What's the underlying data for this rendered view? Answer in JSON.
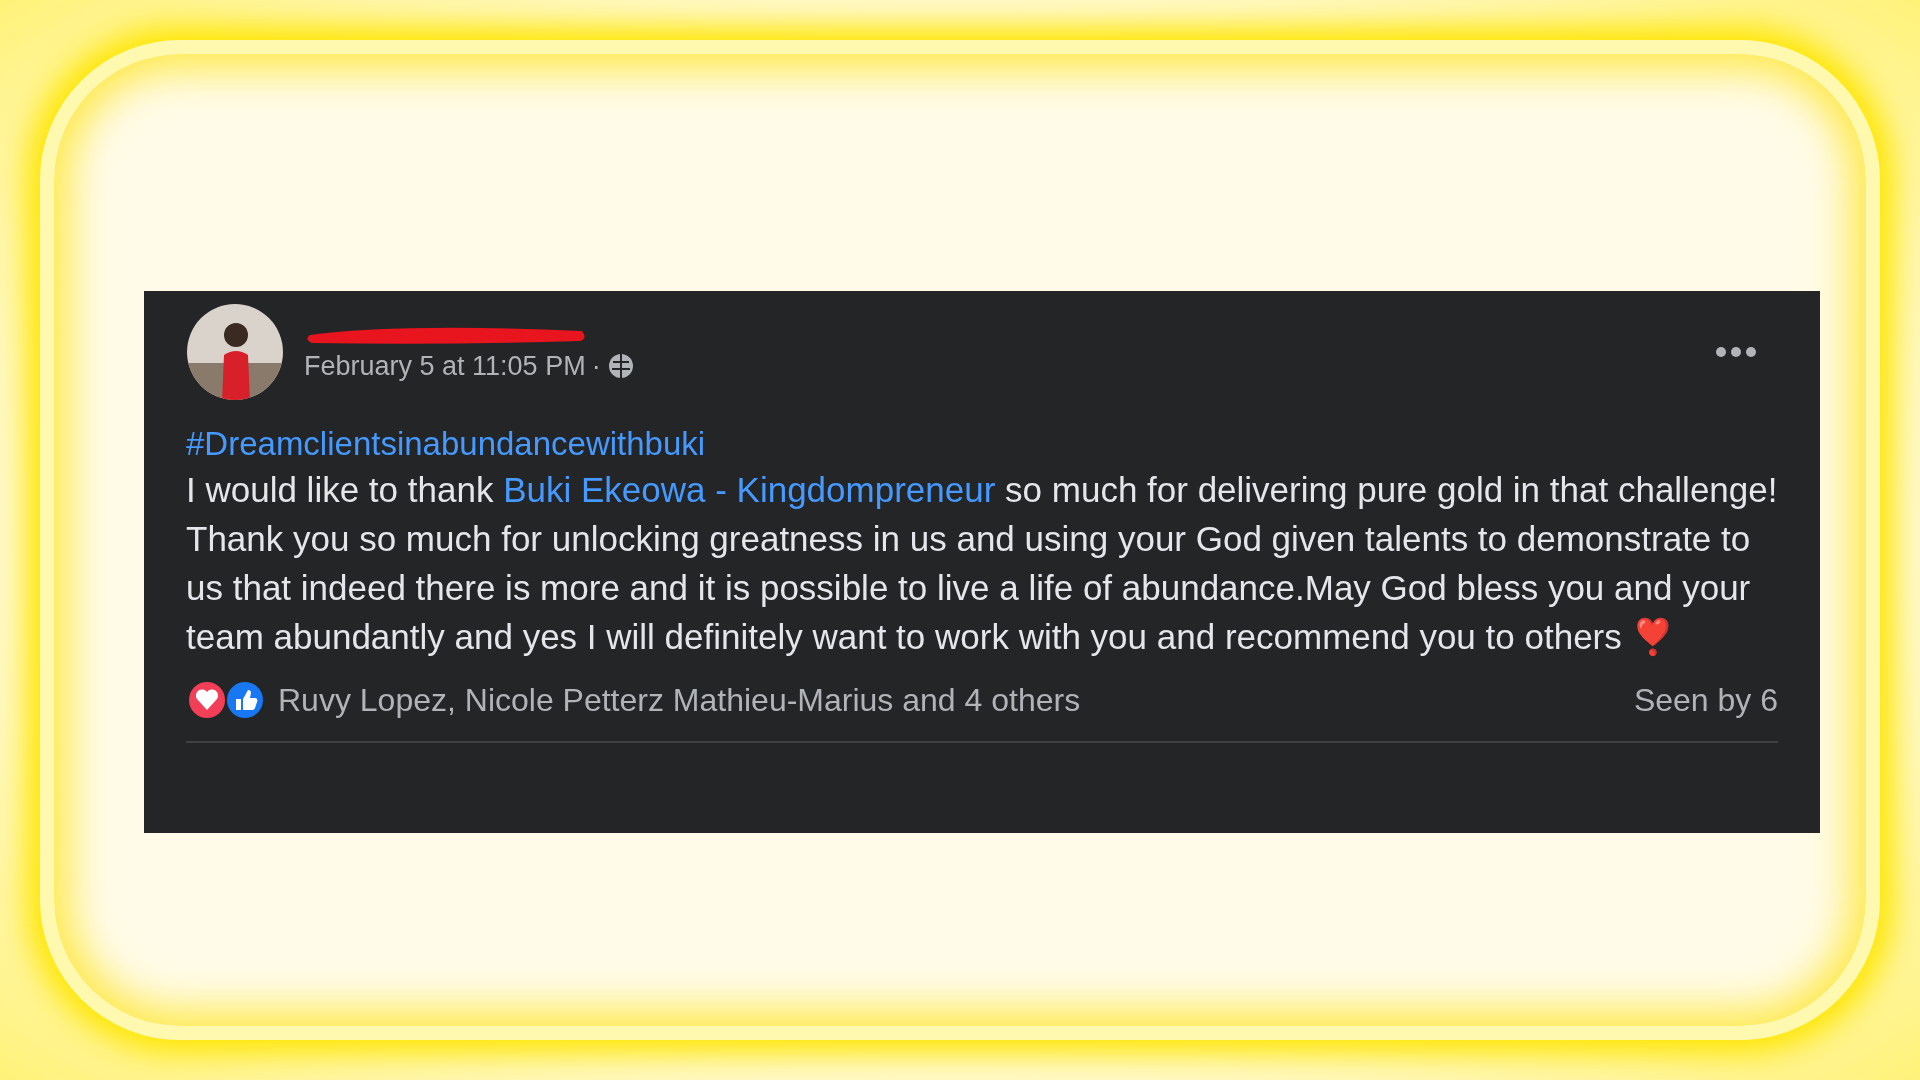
{
  "post": {
    "time": "February 5 at 11:05 PM",
    "separator": "·",
    "redacted_name": true,
    "hashtag": "#Dreamclientsinabundancewithbuki",
    "body": [
      {
        "kind": "text",
        "text": "I would like to thank "
      },
      {
        "kind": "link",
        "text": "Buki Ekeowa - Kingdompreneur"
      },
      {
        "kind": "text",
        "text": " so much for delivering pure gold in that challenge! Thank you so much for unlocking greatness in us and using your God given talents to demonstrate to us that indeed there is more and it is possible to live a life of abundance.May God bless you and your team abundantly and yes I will definitely want to work with you and recommend you to others "
      },
      {
        "kind": "heart",
        "text": "❣️"
      }
    ],
    "reactions": {
      "icons": [
        {
          "kind": "love",
          "color": "#f33e58"
        },
        {
          "kind": "like",
          "color": "#1877f2"
        }
      ],
      "names": "Ruvy Lopez, Nicole Petterz Mathieu-Marius and 4 others"
    },
    "seen_by": "Seen by 6"
  }
}
